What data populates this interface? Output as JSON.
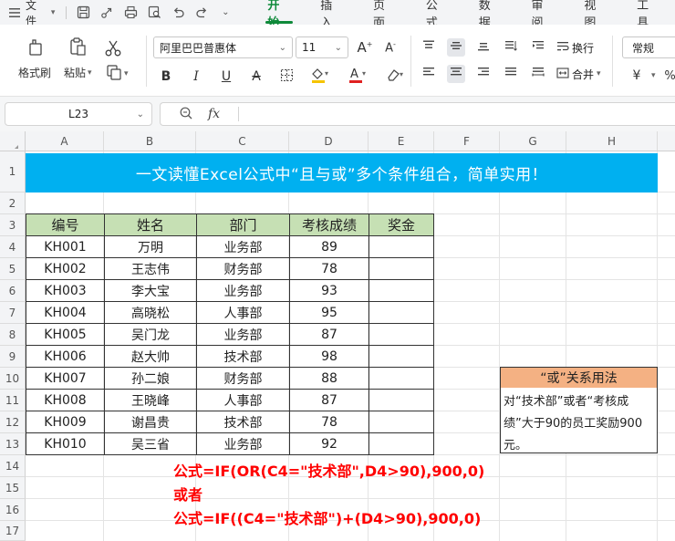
{
  "menubar": {
    "file_label": "文件",
    "tabs": [
      "开始",
      "插入",
      "页面",
      "公式",
      "数据",
      "审阅",
      "视图",
      "工具"
    ],
    "active_tab": "开始"
  },
  "ribbon": {
    "format_painter": "格式刷",
    "paste": "粘贴",
    "font_name": "阿里巴巴普惠体",
    "font_size": "11",
    "wrap_text": "换行",
    "merge": "合并",
    "number_format": "常规",
    "colors": {
      "font_color": "#e02020",
      "fill_color": "#f5c400",
      "accent": "#0f8a3a"
    }
  },
  "formula_bar": {
    "name_box": "L23",
    "fx": "fx",
    "formula": ""
  },
  "sheet": {
    "columns": [
      "A",
      "B",
      "C",
      "D",
      "E",
      "F",
      "G",
      "H"
    ],
    "rows": [
      "1",
      "2",
      "3",
      "4",
      "5",
      "6",
      "7",
      "8",
      "9",
      "10",
      "11",
      "12",
      "13",
      "14",
      "15",
      "16",
      "17"
    ],
    "title": "一文读懂Excel公式中“且与或”多个条件组合，简单实用！",
    "title_bg": "#00b0f0",
    "table_headers": [
      "编号",
      "姓名",
      "部门",
      "考核成绩",
      "奖金"
    ],
    "header_bg": "#c6e0b4",
    "table_rows": [
      [
        "KH001",
        "万明",
        "业务部",
        "89",
        ""
      ],
      [
        "KH002",
        "王志伟",
        "财务部",
        "78",
        ""
      ],
      [
        "KH003",
        "李大宝",
        "业务部",
        "93",
        ""
      ],
      [
        "KH004",
        "高晓松",
        "人事部",
        "95",
        ""
      ],
      [
        "KH005",
        "吴门龙",
        "业务部",
        "87",
        ""
      ],
      [
        "KH006",
        "赵大帅",
        "技术部",
        "98",
        ""
      ],
      [
        "KH007",
        "孙二娘",
        "财务部",
        "88",
        ""
      ],
      [
        "KH008",
        "王晓峰",
        "人事部",
        "87",
        ""
      ],
      [
        "KH009",
        "谢昌贵",
        "技术部",
        "78",
        ""
      ],
      [
        "KH010",
        "吴三省",
        "业务部",
        "92",
        ""
      ]
    ],
    "note": {
      "title": "“或”关系用法",
      "title_bg": "#f4b183",
      "body": "对“技术部”或者“考核成绩”大于90的员工奖励900元。"
    },
    "formulas": {
      "line1": "公式=IF(OR(C4=\"技术部\",D4>90),900,0)",
      "line2": "或者",
      "line3": "公式=IF((C4=\"技术部\")+(D4>90),900,0)",
      "color": "#ff0000"
    }
  }
}
